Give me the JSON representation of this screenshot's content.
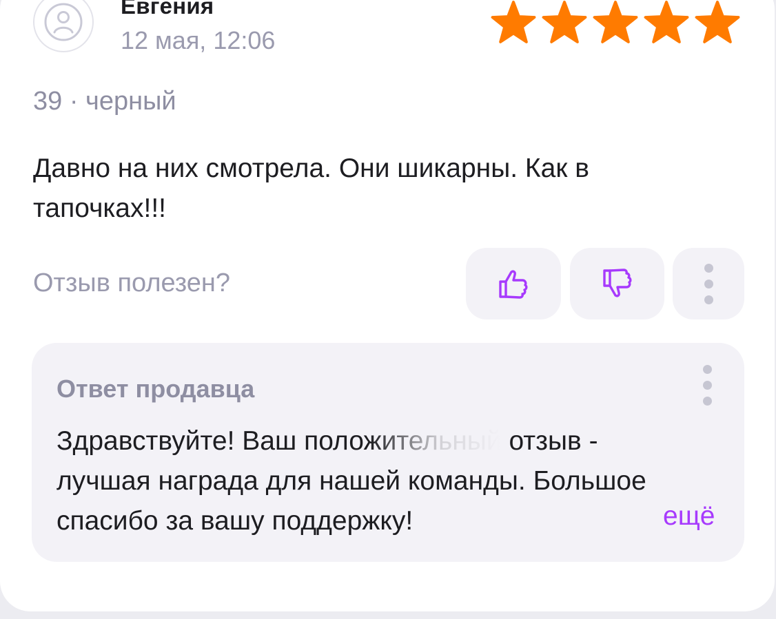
{
  "review": {
    "author": "Евгения",
    "date": "12 мая, 12:06",
    "rating": 5,
    "rating_max": 5,
    "variant": "39 · черный",
    "text": "Давно на них смотрела. Они шикарны. Как в тапочках!!!"
  },
  "feedback": {
    "question": "Отзыв полезен?"
  },
  "seller_reply": {
    "title": "Ответ продавца",
    "text": "Здравствуйте! Ваш положительный отзыв - лучшая награда для нашей команды. Большое спасибо за вашу поддержку!",
    "more_label": "ещё"
  },
  "colors": {
    "star": "#ff7b00",
    "accent": "#a73afd",
    "muted_text": "#9a9aae",
    "panel": "#f3f2f7"
  },
  "icons": {
    "avatar": "user-avatar-icon",
    "like": "thumbs-up-icon",
    "dislike": "thumbs-down-icon",
    "menu": "more-vertical-icon"
  }
}
